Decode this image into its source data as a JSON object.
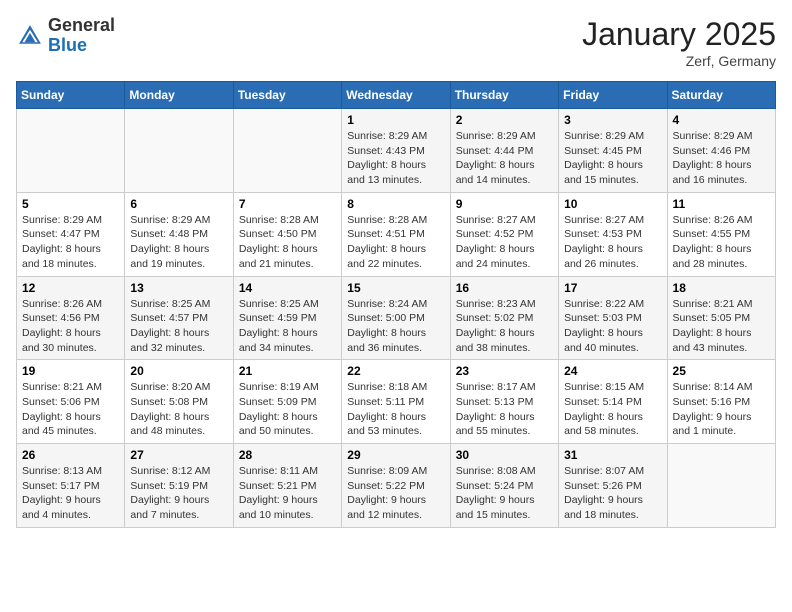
{
  "header": {
    "logo_general": "General",
    "logo_blue": "Blue",
    "month_title": "January 2025",
    "location": "Zerf, Germany"
  },
  "calendar": {
    "days_of_week": [
      "Sunday",
      "Monday",
      "Tuesday",
      "Wednesday",
      "Thursday",
      "Friday",
      "Saturday"
    ],
    "weeks": [
      [
        {
          "day": "",
          "info": ""
        },
        {
          "day": "",
          "info": ""
        },
        {
          "day": "",
          "info": ""
        },
        {
          "day": "1",
          "info": "Sunrise: 8:29 AM\nSunset: 4:43 PM\nDaylight: 8 hours\nand 13 minutes."
        },
        {
          "day": "2",
          "info": "Sunrise: 8:29 AM\nSunset: 4:44 PM\nDaylight: 8 hours\nand 14 minutes."
        },
        {
          "day": "3",
          "info": "Sunrise: 8:29 AM\nSunset: 4:45 PM\nDaylight: 8 hours\nand 15 minutes."
        },
        {
          "day": "4",
          "info": "Sunrise: 8:29 AM\nSunset: 4:46 PM\nDaylight: 8 hours\nand 16 minutes."
        }
      ],
      [
        {
          "day": "5",
          "info": "Sunrise: 8:29 AM\nSunset: 4:47 PM\nDaylight: 8 hours\nand 18 minutes."
        },
        {
          "day": "6",
          "info": "Sunrise: 8:29 AM\nSunset: 4:48 PM\nDaylight: 8 hours\nand 19 minutes."
        },
        {
          "day": "7",
          "info": "Sunrise: 8:28 AM\nSunset: 4:50 PM\nDaylight: 8 hours\nand 21 minutes."
        },
        {
          "day": "8",
          "info": "Sunrise: 8:28 AM\nSunset: 4:51 PM\nDaylight: 8 hours\nand 22 minutes."
        },
        {
          "day": "9",
          "info": "Sunrise: 8:27 AM\nSunset: 4:52 PM\nDaylight: 8 hours\nand 24 minutes."
        },
        {
          "day": "10",
          "info": "Sunrise: 8:27 AM\nSunset: 4:53 PM\nDaylight: 8 hours\nand 26 minutes."
        },
        {
          "day": "11",
          "info": "Sunrise: 8:26 AM\nSunset: 4:55 PM\nDaylight: 8 hours\nand 28 minutes."
        }
      ],
      [
        {
          "day": "12",
          "info": "Sunrise: 8:26 AM\nSunset: 4:56 PM\nDaylight: 8 hours\nand 30 minutes."
        },
        {
          "day": "13",
          "info": "Sunrise: 8:25 AM\nSunset: 4:57 PM\nDaylight: 8 hours\nand 32 minutes."
        },
        {
          "day": "14",
          "info": "Sunrise: 8:25 AM\nSunset: 4:59 PM\nDaylight: 8 hours\nand 34 minutes."
        },
        {
          "day": "15",
          "info": "Sunrise: 8:24 AM\nSunset: 5:00 PM\nDaylight: 8 hours\nand 36 minutes."
        },
        {
          "day": "16",
          "info": "Sunrise: 8:23 AM\nSunset: 5:02 PM\nDaylight: 8 hours\nand 38 minutes."
        },
        {
          "day": "17",
          "info": "Sunrise: 8:22 AM\nSunset: 5:03 PM\nDaylight: 8 hours\nand 40 minutes."
        },
        {
          "day": "18",
          "info": "Sunrise: 8:21 AM\nSunset: 5:05 PM\nDaylight: 8 hours\nand 43 minutes."
        }
      ],
      [
        {
          "day": "19",
          "info": "Sunrise: 8:21 AM\nSunset: 5:06 PM\nDaylight: 8 hours\nand 45 minutes."
        },
        {
          "day": "20",
          "info": "Sunrise: 8:20 AM\nSunset: 5:08 PM\nDaylight: 8 hours\nand 48 minutes."
        },
        {
          "day": "21",
          "info": "Sunrise: 8:19 AM\nSunset: 5:09 PM\nDaylight: 8 hours\nand 50 minutes."
        },
        {
          "day": "22",
          "info": "Sunrise: 8:18 AM\nSunset: 5:11 PM\nDaylight: 8 hours\nand 53 minutes."
        },
        {
          "day": "23",
          "info": "Sunrise: 8:17 AM\nSunset: 5:13 PM\nDaylight: 8 hours\nand 55 minutes."
        },
        {
          "day": "24",
          "info": "Sunrise: 8:15 AM\nSunset: 5:14 PM\nDaylight: 8 hours\nand 58 minutes."
        },
        {
          "day": "25",
          "info": "Sunrise: 8:14 AM\nSunset: 5:16 PM\nDaylight: 9 hours\nand 1 minute."
        }
      ],
      [
        {
          "day": "26",
          "info": "Sunrise: 8:13 AM\nSunset: 5:17 PM\nDaylight: 9 hours\nand 4 minutes."
        },
        {
          "day": "27",
          "info": "Sunrise: 8:12 AM\nSunset: 5:19 PM\nDaylight: 9 hours\nand 7 minutes."
        },
        {
          "day": "28",
          "info": "Sunrise: 8:11 AM\nSunset: 5:21 PM\nDaylight: 9 hours\nand 10 minutes."
        },
        {
          "day": "29",
          "info": "Sunrise: 8:09 AM\nSunset: 5:22 PM\nDaylight: 9 hours\nand 12 minutes."
        },
        {
          "day": "30",
          "info": "Sunrise: 8:08 AM\nSunset: 5:24 PM\nDaylight: 9 hours\nand 15 minutes."
        },
        {
          "day": "31",
          "info": "Sunrise: 8:07 AM\nSunset: 5:26 PM\nDaylight: 9 hours\nand 18 minutes."
        },
        {
          "day": "",
          "info": ""
        }
      ]
    ]
  }
}
